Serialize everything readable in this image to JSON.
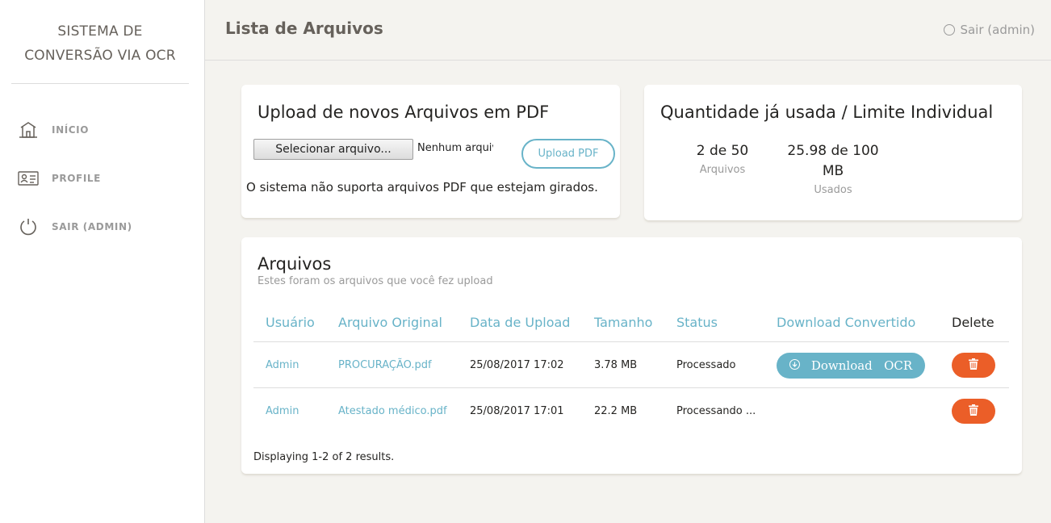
{
  "sidebar": {
    "brand_line1": "SISTEMA DE",
    "brand_line2": "CONVERSÃO VIA OCR",
    "items": [
      {
        "label": "INÍCIO",
        "icon": "home-icon"
      },
      {
        "label": "PROFILE",
        "icon": "id-card-icon"
      },
      {
        "label": "SAIR (ADMIN)",
        "icon": "power-icon"
      }
    ]
  },
  "header": {
    "title": "Lista de Arquivos",
    "logout_label": "Sair (admin)"
  },
  "upload_card": {
    "title": "Upload de novos Arquivos em PDF",
    "file_button_label": "Selecionar arquivo...",
    "file_status": "Nenhum arquivo selecionado.",
    "upload_button_label": "Upload PDF",
    "note": "O sistema não suporta arquivos PDF que estejam girados."
  },
  "quota_card": {
    "title": "Quantidade já usada / Limite Individual",
    "files_value": "2 de 50",
    "files_label": "Arquivos",
    "size_value_line1": "25.98 de 100",
    "size_value_line2": "MB",
    "size_label": "Usados"
  },
  "files_card": {
    "title": "Arquivos",
    "subtitle": "Estes foram os arquivos que você fez upload",
    "columns": [
      "Usuário",
      "Arquivo Original",
      "Data de Upload",
      "Tamanho",
      "Status",
      "Download Convertido",
      "Delete"
    ],
    "rows": [
      {
        "user": "Admin",
        "file": "PROCURAÇÃO.pdf",
        "date": "25/08/2017 17:02",
        "size": "3.78 MB",
        "status": "Processado",
        "download_label": "Download   OCR"
      },
      {
        "user": "Admin",
        "file": "Atestado médico.pdf",
        "date": "25/08/2017 17:01",
        "size": "22.2 MB",
        "status": "Processando ...",
        "download_label": ""
      }
    ],
    "summary": "Displaying 1-2 of 2 results."
  },
  "colors": {
    "accent": "#68b3c8",
    "danger": "#eb5e28",
    "background": "#f4f3ef"
  }
}
